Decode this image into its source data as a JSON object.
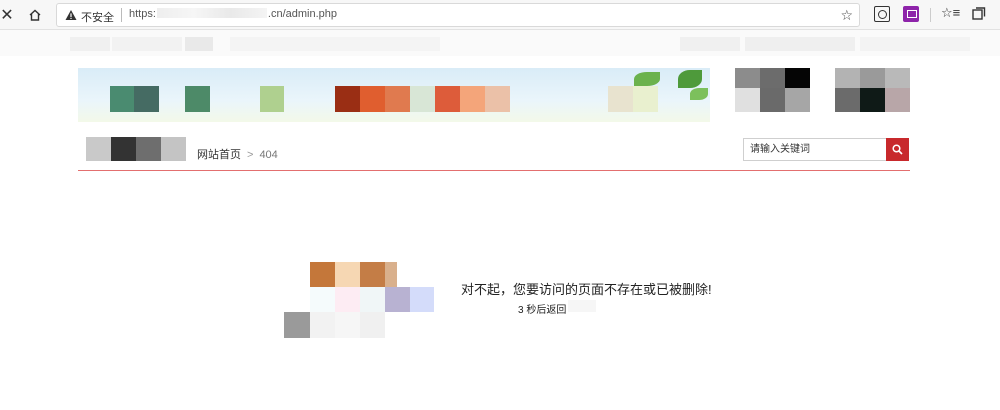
{
  "browser": {
    "security_label": "不安全",
    "url_prefix": "https:",
    "url_suffix": ".cn/admin.php",
    "star_icon": "star-icon",
    "colors": {
      "extension_purple": "#8e24aa"
    }
  },
  "header": {
    "breadcrumb": [
      {
        "label": "网站首页"
      },
      {
        "label": "404"
      }
    ],
    "breadcrumb_separator": ">",
    "search": {
      "placeholder": "请输入关键词",
      "value": ""
    },
    "colors": {
      "accent": "#c8292c",
      "divider": "#e36f6f"
    }
  },
  "error": {
    "message": "对不起，您要访问的页面不存在或已被删除!",
    "countdown": "3 秒后返回"
  }
}
